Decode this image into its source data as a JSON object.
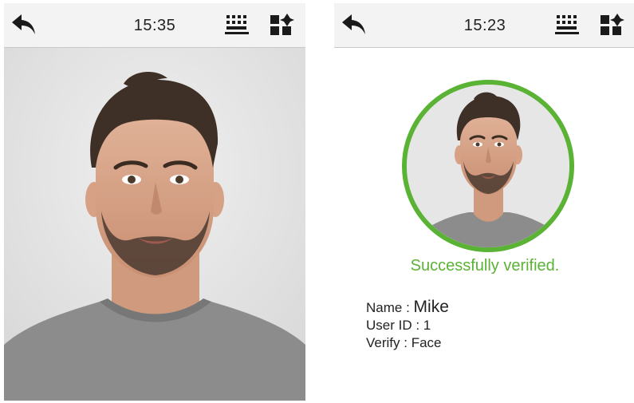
{
  "left_screen": {
    "time": "15:35",
    "icons": {
      "back": "back-arrow-icon",
      "keyboard": "keyboard-icon",
      "menu": "menu-grid-icon"
    }
  },
  "right_screen": {
    "time": "15:23",
    "status": "Successfully verified.",
    "name_label": "Name :",
    "name_value": "Mike",
    "user_id_label": "User ID :",
    "user_id_value": "1",
    "verify_label": "Verify :",
    "verify_value": "Face"
  },
  "colors": {
    "success_green": "#5ab334",
    "topbar_bg": "#f3f3f3"
  }
}
